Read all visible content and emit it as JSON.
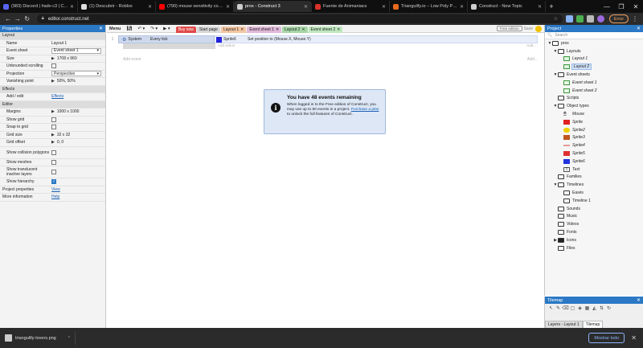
{
  "browser": {
    "tabs": [
      {
        "title": "(983) Discord | #adv-c3 | C...",
        "color": "#5865f2"
      },
      {
        "title": "(1) Descubrir - Roblox",
        "color": "#dddddd"
      },
      {
        "title": "(790) mouse sensitivity constr...",
        "color": "#ff0000"
      },
      {
        "title": "prox - Construct 3",
        "color": "#cccccc"
      },
      {
        "title": "Fuente de Animaniacs",
        "color": "#d9322b"
      },
      {
        "title": "Triangulify.io – Low Poly Pattern G...",
        "color": "#e86a1f"
      },
      {
        "title": "Construct - New Topic",
        "color": "#cccccc"
      }
    ],
    "active_tab": 3,
    "url": "editor.construct.net",
    "error_button": "Error",
    "new_tab_symbol": "+",
    "window_controls": [
      "—",
      "❐",
      "✕"
    ]
  },
  "properties": {
    "header": "Properties",
    "rows": [
      {
        "type": "section",
        "label": "Layout"
      },
      {
        "type": "text",
        "label": "Name",
        "value": "Layout 1"
      },
      {
        "type": "select",
        "label": "Event sheet",
        "value": "Event sheet 1"
      },
      {
        "type": "text",
        "label": "Size",
        "value": "1708 x 960",
        "expand": true
      },
      {
        "type": "check",
        "label": "Unbounded scrolling",
        "checked": false
      },
      {
        "type": "select",
        "label": "Projection",
        "value": "Perspective"
      },
      {
        "type": "text",
        "label": "Vanishing point",
        "value": "50%, 50%",
        "expand": true
      },
      {
        "type": "section",
        "label": "Effects"
      },
      {
        "type": "link",
        "label": "Add / edit",
        "value": "Effects"
      },
      {
        "type": "section",
        "label": "Editor"
      },
      {
        "type": "text",
        "label": "Margins",
        "value": "1000 x 1000",
        "expand": true
      },
      {
        "type": "check",
        "label": "Show grid",
        "checked": false
      },
      {
        "type": "check",
        "label": "Snap to grid",
        "checked": false
      },
      {
        "type": "text",
        "label": "Grid size",
        "value": "32 x 32",
        "expand": true
      },
      {
        "type": "text",
        "label": "Grid offset",
        "value": "0, 0",
        "expand": true
      },
      {
        "type": "check",
        "label": "Show collision polygons",
        "checked": false,
        "tall": true
      },
      {
        "type": "check",
        "label": "Show meshes",
        "checked": false
      },
      {
        "type": "check",
        "label": "Show translucent inactive layers",
        "checked": false,
        "tall": true
      },
      {
        "type": "check",
        "label": "Show hierarchy",
        "checked": true
      },
      {
        "type": "plainlink",
        "label": "Project properties",
        "value": "View"
      },
      {
        "type": "plainlink",
        "label": "More information",
        "value": "Help"
      }
    ]
  },
  "editor": {
    "menu_label": "Menu",
    "tabs": [
      {
        "label": "Buy now",
        "bg": "#e04a4a",
        "fg": "#ffffff",
        "close": false
      },
      {
        "label": "Start page",
        "bg": "#d8d8d8",
        "fg": "#222222",
        "close": false
      },
      {
        "label": "Layout 1",
        "bg": "#f4c6a2",
        "fg": "#222222",
        "close": true
      },
      {
        "label": "Event sheet 1",
        "bg": "#e0b8d8",
        "fg": "#222222",
        "close": true
      },
      {
        "label": "Layout 2",
        "bg": "#a6d6a6",
        "fg": "#222222",
        "close": true
      },
      {
        "label": "Event sheet 2",
        "bg": "#bfe8bf",
        "fg": "#222222",
        "close": true
      }
    ],
    "free_edition_label": "Free edition",
    "save_label": "Save",
    "event": {
      "number": "1",
      "object": "System",
      "condition": "Every tick",
      "action_object": "Sprite6",
      "action": "Set position to (Mouse.X, Mouse.Y)",
      "add_action": "Add action",
      "add_action_right": "Add..."
    },
    "add_event": "Add event",
    "add_event_right": "Add..."
  },
  "notice": {
    "title": "You have 48 events remaining",
    "line1": "When logged in to the Free edition of Construct, you may use up to 50 events in a project.",
    "link": "Purchase a plan",
    "line2": " to unlock the full features of Construct."
  },
  "project": {
    "header": "Project",
    "search_placeholder": "Search",
    "tree": [
      {
        "depth": 0,
        "arrow": "▼",
        "icon": "folder",
        "label": "prox"
      },
      {
        "depth": 1,
        "arrow": "▼",
        "icon": "folder",
        "label": "Layouts"
      },
      {
        "depth": 2,
        "arrow": "",
        "icon": "layout",
        "label": "Layout 1",
        "italic": true
      },
      {
        "depth": 2,
        "arrow": "",
        "icon": "layout",
        "label": "Layout 2",
        "italic": true,
        "highlight": true
      },
      {
        "depth": 1,
        "arrow": "▼",
        "icon": "folder",
        "label": "Event sheets"
      },
      {
        "depth": 2,
        "arrow": "",
        "icon": "evsheet",
        "label": "Event sheet 1",
        "italic": true
      },
      {
        "depth": 2,
        "arrow": "",
        "icon": "evsheet",
        "label": "Event sheet 2",
        "italic": true
      },
      {
        "depth": 1,
        "arrow": "",
        "icon": "folder",
        "label": "Scripts"
      },
      {
        "depth": 1,
        "arrow": "▼",
        "icon": "folder",
        "label": "Object types"
      },
      {
        "depth": 2,
        "arrow": "",
        "icon": "mouse",
        "label": "Mouse",
        "italic": true
      },
      {
        "depth": 2,
        "arrow": "",
        "icon": "sprite",
        "color": "#e02020",
        "label": "Sprite",
        "italic": true
      },
      {
        "depth": 2,
        "arrow": "",
        "icon": "circle",
        "color": "#f0d000",
        "label": "Sprite2",
        "italic": true
      },
      {
        "depth": 2,
        "arrow": "",
        "icon": "sprite",
        "color": "#c0561e",
        "label": "Sprite3",
        "italic": true
      },
      {
        "depth": 2,
        "arrow": "",
        "icon": "line",
        "color": "#d44040",
        "label": "Sprite4",
        "italic": true
      },
      {
        "depth": 2,
        "arrow": "",
        "icon": "sprite",
        "color": "#e03030",
        "label": "Sprite5",
        "italic": true
      },
      {
        "depth": 2,
        "arrow": "",
        "icon": "sprite",
        "color": "#2233dd",
        "label": "Sprite6",
        "italic": true
      },
      {
        "depth": 2,
        "arrow": "",
        "icon": "text",
        "label": "Text",
        "italic": true
      },
      {
        "depth": 1,
        "arrow": "",
        "icon": "folder",
        "label": "Families"
      },
      {
        "depth": 1,
        "arrow": "▼",
        "icon": "folder",
        "label": "Timelines"
      },
      {
        "depth": 2,
        "arrow": "",
        "icon": "folder",
        "label": "Easés"
      },
      {
        "depth": 2,
        "arrow": "",
        "icon": "folder",
        "label": "Timeline 1"
      },
      {
        "depth": 1,
        "arrow": "",
        "icon": "folder",
        "label": "Sounds"
      },
      {
        "depth": 1,
        "arrow": "",
        "icon": "folder",
        "label": "Music"
      },
      {
        "depth": 1,
        "arrow": "",
        "icon": "folder",
        "label": "Videos"
      },
      {
        "depth": 1,
        "arrow": "",
        "icon": "folder",
        "label": "Fonts"
      },
      {
        "depth": 1,
        "arrow": "▶",
        "icon": "folderdark",
        "label": "Icons"
      },
      {
        "depth": 1,
        "arrow": "",
        "icon": "folder",
        "label": "Files"
      }
    ]
  },
  "tilemap": {
    "header": "Tilemap",
    "tabs": [
      "Layers - Layout 1",
      "Tilemap"
    ],
    "active_tab": 1
  },
  "downloads": {
    "file": "triangulify-lovers.png",
    "show_all": "Mostrar todo"
  }
}
